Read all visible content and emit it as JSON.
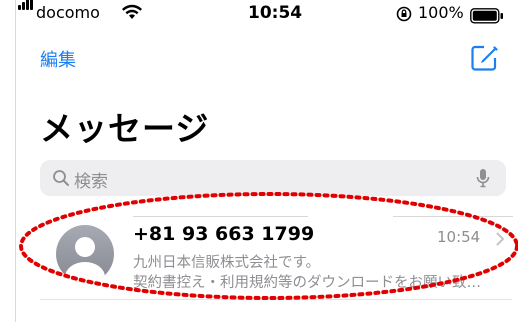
{
  "status_bar": {
    "carrier": "docomo",
    "time": "10:54",
    "battery": "100%",
    "signal_icon": "signal-bars-icon",
    "wifi_icon": "wifi-icon",
    "rotation_lock_icon": "rotation-lock-icon",
    "battery_icon": "battery-icon"
  },
  "nav": {
    "edit_label": "編集",
    "compose_icon": "compose-icon"
  },
  "title": "メッセージ",
  "search": {
    "placeholder": "検索",
    "icon": "search-icon",
    "mic_icon": "microphone-icon"
  },
  "conversations": [
    {
      "sender": "+81 93 663 1799",
      "time": "10:54",
      "preview_line1": "九州日本信販株式会社です。",
      "preview_line2": "契約書控え・利用規約等のダウンロードをお願い致…"
    }
  ],
  "annotation": {
    "color": "#e00000",
    "style": "dotted-ellipse"
  },
  "colors": {
    "accent": "#1a7ff0",
    "secondary_text": "#8e8e93",
    "search_bg": "#eeeef0"
  }
}
